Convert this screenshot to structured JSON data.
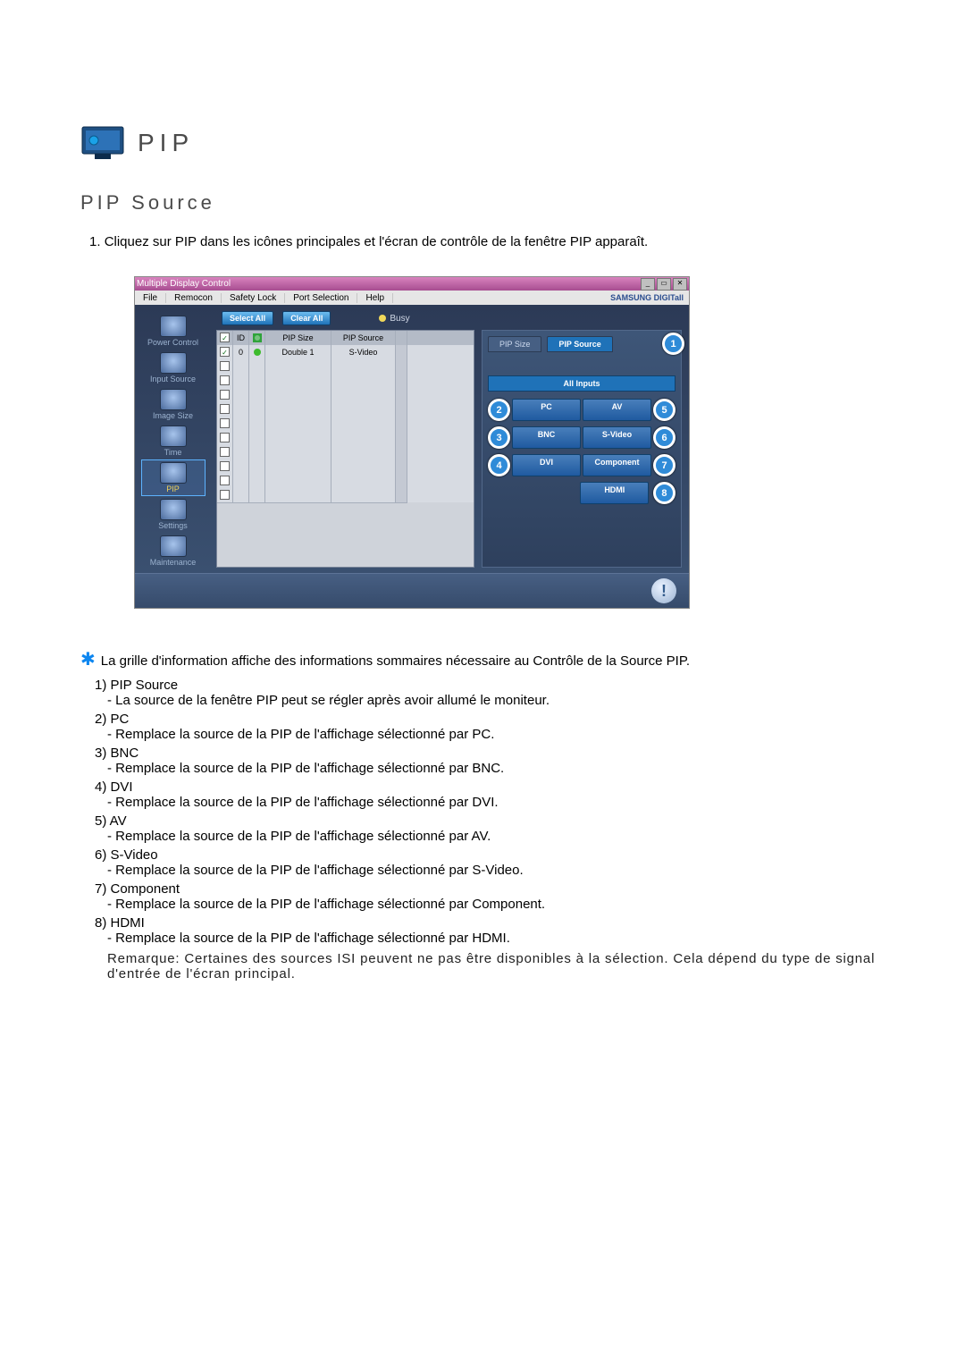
{
  "icon_name": "monitor-icon",
  "header_title": "PIP",
  "section_title": "PIP Source",
  "instruction_num": "1.",
  "instruction": "Cliquez sur PIP dans les icônes principales et l'écran de contrôle de la fenêtre PIP apparaît.",
  "window": {
    "app_title": "Multiple Display Control",
    "menus": [
      "File",
      "Remocon",
      "Safety Lock",
      "Port Selection",
      "Help"
    ],
    "brand": "SAMSUNG DIGITall",
    "toolbar": {
      "select_all": "Select All",
      "clear_all": "Clear All",
      "busy": "Busy"
    },
    "sidebar": [
      {
        "label": "Power Control",
        "id": "power-control"
      },
      {
        "label": "Input Source",
        "id": "input-source"
      },
      {
        "label": "Image Size",
        "id": "image-size"
      },
      {
        "label": "Time",
        "id": "time"
      },
      {
        "label": "PIP",
        "id": "pip",
        "selected": true
      },
      {
        "label": "Settings",
        "id": "settings"
      },
      {
        "label": "Maintenance",
        "id": "maintenance"
      }
    ],
    "columns": [
      "",
      "ID",
      "",
      "PIP Size",
      "PIP Source"
    ],
    "rows": [
      {
        "chk": true,
        "id": "0",
        "status": "green",
        "size": "Double 1",
        "source": "S-Video"
      },
      {
        "chk": false,
        "id": "",
        "status": "",
        "size": "",
        "source": ""
      },
      {
        "chk": false,
        "id": "",
        "status": "",
        "size": "",
        "source": ""
      },
      {
        "chk": false,
        "id": "",
        "status": "",
        "size": "",
        "source": ""
      },
      {
        "chk": false,
        "id": "",
        "status": "",
        "size": "",
        "source": ""
      },
      {
        "chk": false,
        "id": "",
        "status": "",
        "size": "",
        "source": ""
      },
      {
        "chk": false,
        "id": "",
        "status": "",
        "size": "",
        "source": ""
      },
      {
        "chk": false,
        "id": "",
        "status": "",
        "size": "",
        "source": ""
      },
      {
        "chk": false,
        "id": "",
        "status": "",
        "size": "",
        "source": ""
      },
      {
        "chk": false,
        "id": "",
        "status": "",
        "size": "",
        "source": ""
      },
      {
        "chk": false,
        "id": "",
        "status": "",
        "size": "",
        "source": ""
      }
    ],
    "panel": {
      "tab_left": "PIP Size",
      "tab_right_active": "PIP Source",
      "header": "All Inputs",
      "left_col": [
        "PC",
        "BNC",
        "DVI"
      ],
      "right_col": [
        "AV",
        "S-Video",
        "Component",
        "HDMI"
      ]
    },
    "callouts": {
      "c1": "1",
      "c2": "2",
      "c3": "3",
      "c4": "4",
      "c5": "5",
      "c6": "6",
      "c7": "7",
      "c8": "8"
    }
  },
  "note": "La grille d'information affiche des informations sommaires nécessaire au Contrôle de la Source PIP.",
  "items": [
    {
      "n": "1)",
      "t": "PIP Source",
      "d": "- La source de la fenêtre PIP peut se régler après avoir allumé le moniteur."
    },
    {
      "n": "2)",
      "t": "PC",
      "d": "- Remplace la source de la PIP de l'affichage sélectionné par PC."
    },
    {
      "n": "3)",
      "t": "BNC",
      "d": "- Remplace la source de la PIP de l'affichage sélectionné par BNC."
    },
    {
      "n": "4)",
      "t": "DVI",
      "d": "- Remplace la source de la PIP de l'affichage sélectionné par DVI."
    },
    {
      "n": "5)",
      "t": "AV",
      "d": "- Remplace la source de la PIP de l'affichage sélectionné par AV."
    },
    {
      "n": "6)",
      "t": "S-Video",
      "d": "- Remplace la source de la PIP de l'affichage sélectionné par S-Video."
    },
    {
      "n": "7)",
      "t": "Component",
      "d": "- Remplace la source de la PIP de l'affichage sélectionné par Component."
    },
    {
      "n": "8)",
      "t": "HDMI",
      "d": "- Remplace la source de la PIP de l'affichage sélectionné par HDMI."
    }
  ],
  "remark": "Remarque: Certaines des sources ISI peuvent ne pas être disponibles à la sélection. Cela dépend du type de signal d'entrée de l'écran principal."
}
